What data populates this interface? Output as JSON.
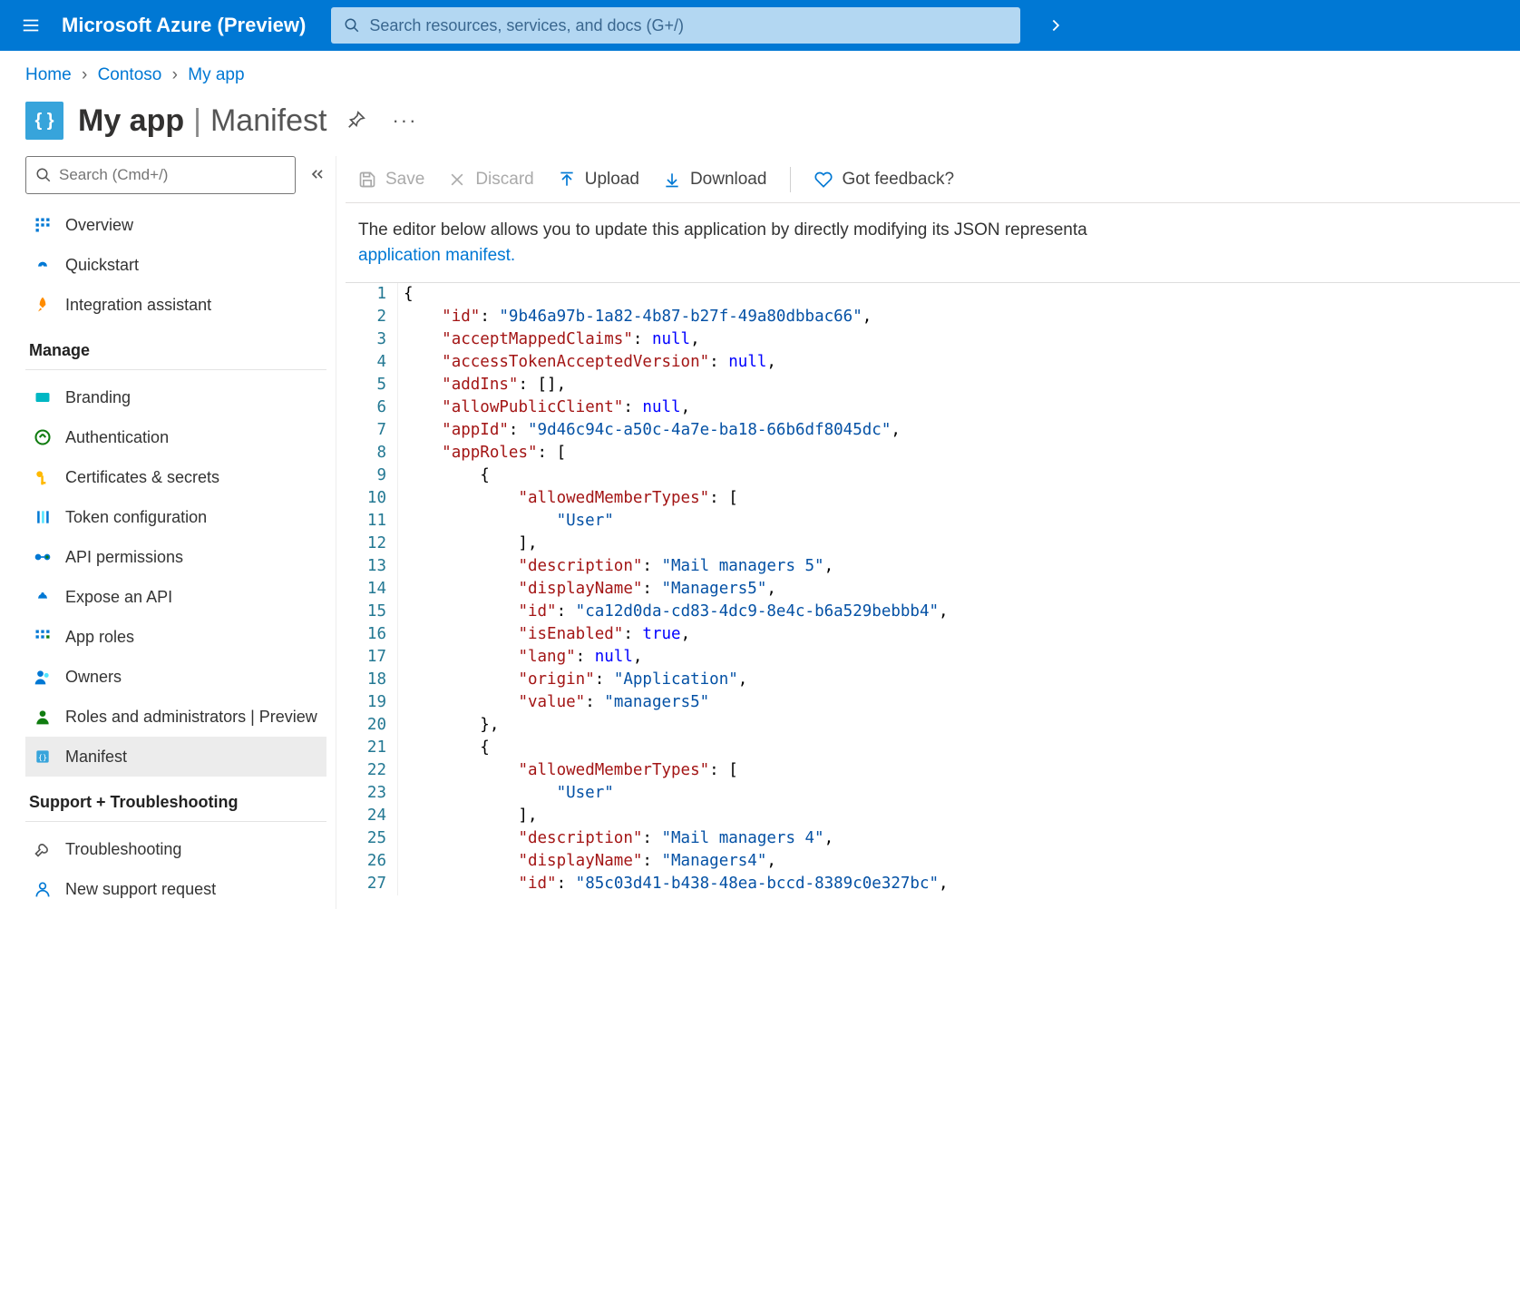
{
  "topbar": {
    "brand": "Microsoft Azure (Preview)",
    "search_placeholder": "Search resources, services, and docs (G+/)"
  },
  "breadcrumb": {
    "items": [
      "Home",
      "Contoso",
      "My app"
    ]
  },
  "header": {
    "icon_glyph": "{ }",
    "title": "My app",
    "subtitle": "Manifest"
  },
  "sidebar": {
    "search_placeholder": "Search (Cmd+/)",
    "top_items": [
      {
        "label": "Overview",
        "icon": "overview"
      },
      {
        "label": "Quickstart",
        "icon": "quickstart"
      },
      {
        "label": "Integration assistant",
        "icon": "rocket"
      }
    ],
    "manage_label": "Manage",
    "manage_items": [
      {
        "label": "Branding",
        "icon": "branding"
      },
      {
        "label": "Authentication",
        "icon": "auth"
      },
      {
        "label": "Certificates & secrets",
        "icon": "key"
      },
      {
        "label": "Token configuration",
        "icon": "token"
      },
      {
        "label": "API permissions",
        "icon": "api-perm"
      },
      {
        "label": "Expose an API",
        "icon": "expose"
      },
      {
        "label": "App roles",
        "icon": "approles"
      },
      {
        "label": "Owners",
        "icon": "owners"
      },
      {
        "label": "Roles and administrators | Preview",
        "icon": "roles"
      },
      {
        "label": "Manifest",
        "icon": "manifest",
        "active": true
      }
    ],
    "support_label": "Support + Troubleshooting",
    "support_items": [
      {
        "label": "Troubleshooting",
        "icon": "wrench"
      },
      {
        "label": "New support request",
        "icon": "support"
      }
    ]
  },
  "toolbar": {
    "save": "Save",
    "discard": "Discard",
    "upload": "Upload",
    "download": "Download",
    "feedback": "Got feedback?"
  },
  "description": {
    "text": "The editor below allows you to update this application by directly modifying its JSON representa",
    "link": "application manifest."
  },
  "code_lines": [
    [
      {
        "t": "{",
        "c": "p"
      }
    ],
    [
      {
        "t": "    ",
        "c": "p"
      },
      {
        "t": "\"id\"",
        "c": "key"
      },
      {
        "t": ": ",
        "c": "p"
      },
      {
        "t": "\"9b46a97b-1a82-4b87-b27f-49a80dbbac66\"",
        "c": "str"
      },
      {
        "t": ",",
        "c": "p"
      }
    ],
    [
      {
        "t": "    ",
        "c": "p"
      },
      {
        "t": "\"acceptMappedClaims\"",
        "c": "key"
      },
      {
        "t": ": ",
        "c": "p"
      },
      {
        "t": "null",
        "c": "kw"
      },
      {
        "t": ",",
        "c": "p"
      }
    ],
    [
      {
        "t": "    ",
        "c": "p"
      },
      {
        "t": "\"accessTokenAcceptedVersion\"",
        "c": "key"
      },
      {
        "t": ": ",
        "c": "p"
      },
      {
        "t": "null",
        "c": "kw"
      },
      {
        "t": ",",
        "c": "p"
      }
    ],
    [
      {
        "t": "    ",
        "c": "p"
      },
      {
        "t": "\"addIns\"",
        "c": "key"
      },
      {
        "t": ": [],",
        "c": "p"
      }
    ],
    [
      {
        "t": "    ",
        "c": "p"
      },
      {
        "t": "\"allowPublicClient\"",
        "c": "key"
      },
      {
        "t": ": ",
        "c": "p"
      },
      {
        "t": "null",
        "c": "kw"
      },
      {
        "t": ",",
        "c": "p"
      }
    ],
    [
      {
        "t": "    ",
        "c": "p"
      },
      {
        "t": "\"appId\"",
        "c": "key"
      },
      {
        "t": ": ",
        "c": "p"
      },
      {
        "t": "\"9d46c94c-a50c-4a7e-ba18-66b6df8045dc\"",
        "c": "str"
      },
      {
        "t": ",",
        "c": "p"
      }
    ],
    [
      {
        "t": "    ",
        "c": "p"
      },
      {
        "t": "\"appRoles\"",
        "c": "key"
      },
      {
        "t": ": [",
        "c": "p"
      }
    ],
    [
      {
        "t": "        {",
        "c": "p"
      }
    ],
    [
      {
        "t": "            ",
        "c": "p"
      },
      {
        "t": "\"allowedMemberTypes\"",
        "c": "key"
      },
      {
        "t": ": [",
        "c": "p"
      }
    ],
    [
      {
        "t": "                ",
        "c": "p"
      },
      {
        "t": "\"User\"",
        "c": "str"
      }
    ],
    [
      {
        "t": "            ],",
        "c": "p"
      }
    ],
    [
      {
        "t": "            ",
        "c": "p"
      },
      {
        "t": "\"description\"",
        "c": "key"
      },
      {
        "t": ": ",
        "c": "p"
      },
      {
        "t": "\"Mail managers 5\"",
        "c": "str"
      },
      {
        "t": ",",
        "c": "p"
      }
    ],
    [
      {
        "t": "            ",
        "c": "p"
      },
      {
        "t": "\"displayName\"",
        "c": "key"
      },
      {
        "t": ": ",
        "c": "p"
      },
      {
        "t": "\"Managers5\"",
        "c": "str"
      },
      {
        "t": ",",
        "c": "p"
      }
    ],
    [
      {
        "t": "            ",
        "c": "p"
      },
      {
        "t": "\"id\"",
        "c": "key"
      },
      {
        "t": ": ",
        "c": "p"
      },
      {
        "t": "\"ca12d0da-cd83-4dc9-8e4c-b6a529bebbb4\"",
        "c": "str"
      },
      {
        "t": ",",
        "c": "p"
      }
    ],
    [
      {
        "t": "            ",
        "c": "p"
      },
      {
        "t": "\"isEnabled\"",
        "c": "key"
      },
      {
        "t": ": ",
        "c": "p"
      },
      {
        "t": "true",
        "c": "kw"
      },
      {
        "t": ",",
        "c": "p"
      }
    ],
    [
      {
        "t": "            ",
        "c": "p"
      },
      {
        "t": "\"lang\"",
        "c": "key"
      },
      {
        "t": ": ",
        "c": "p"
      },
      {
        "t": "null",
        "c": "kw"
      },
      {
        "t": ",",
        "c": "p"
      }
    ],
    [
      {
        "t": "            ",
        "c": "p"
      },
      {
        "t": "\"origin\"",
        "c": "key"
      },
      {
        "t": ": ",
        "c": "p"
      },
      {
        "t": "\"Application\"",
        "c": "str"
      },
      {
        "t": ",",
        "c": "p"
      }
    ],
    [
      {
        "t": "            ",
        "c": "p"
      },
      {
        "t": "\"value\"",
        "c": "key"
      },
      {
        "t": ": ",
        "c": "p"
      },
      {
        "t": "\"managers5\"",
        "c": "str"
      }
    ],
    [
      {
        "t": "        },",
        "c": "p"
      }
    ],
    [
      {
        "t": "        {",
        "c": "p"
      }
    ],
    [
      {
        "t": "            ",
        "c": "p"
      },
      {
        "t": "\"allowedMemberTypes\"",
        "c": "key"
      },
      {
        "t": ": [",
        "c": "p"
      }
    ],
    [
      {
        "t": "                ",
        "c": "p"
      },
      {
        "t": "\"User\"",
        "c": "str"
      }
    ],
    [
      {
        "t": "            ],",
        "c": "p"
      }
    ],
    [
      {
        "t": "            ",
        "c": "p"
      },
      {
        "t": "\"description\"",
        "c": "key"
      },
      {
        "t": ": ",
        "c": "p"
      },
      {
        "t": "\"Mail managers 4\"",
        "c": "str"
      },
      {
        "t": ",",
        "c": "p"
      }
    ],
    [
      {
        "t": "            ",
        "c": "p"
      },
      {
        "t": "\"displayName\"",
        "c": "key"
      },
      {
        "t": ": ",
        "c": "p"
      },
      {
        "t": "\"Managers4\"",
        "c": "str"
      },
      {
        "t": ",",
        "c": "p"
      }
    ],
    [
      {
        "t": "            ",
        "c": "p"
      },
      {
        "t": "\"id\"",
        "c": "key"
      },
      {
        "t": ": ",
        "c": "p"
      },
      {
        "t": "\"85c03d41-b438-48ea-bccd-8389c0e327bc\"",
        "c": "str"
      },
      {
        "t": ",",
        "c": "p"
      }
    ]
  ]
}
